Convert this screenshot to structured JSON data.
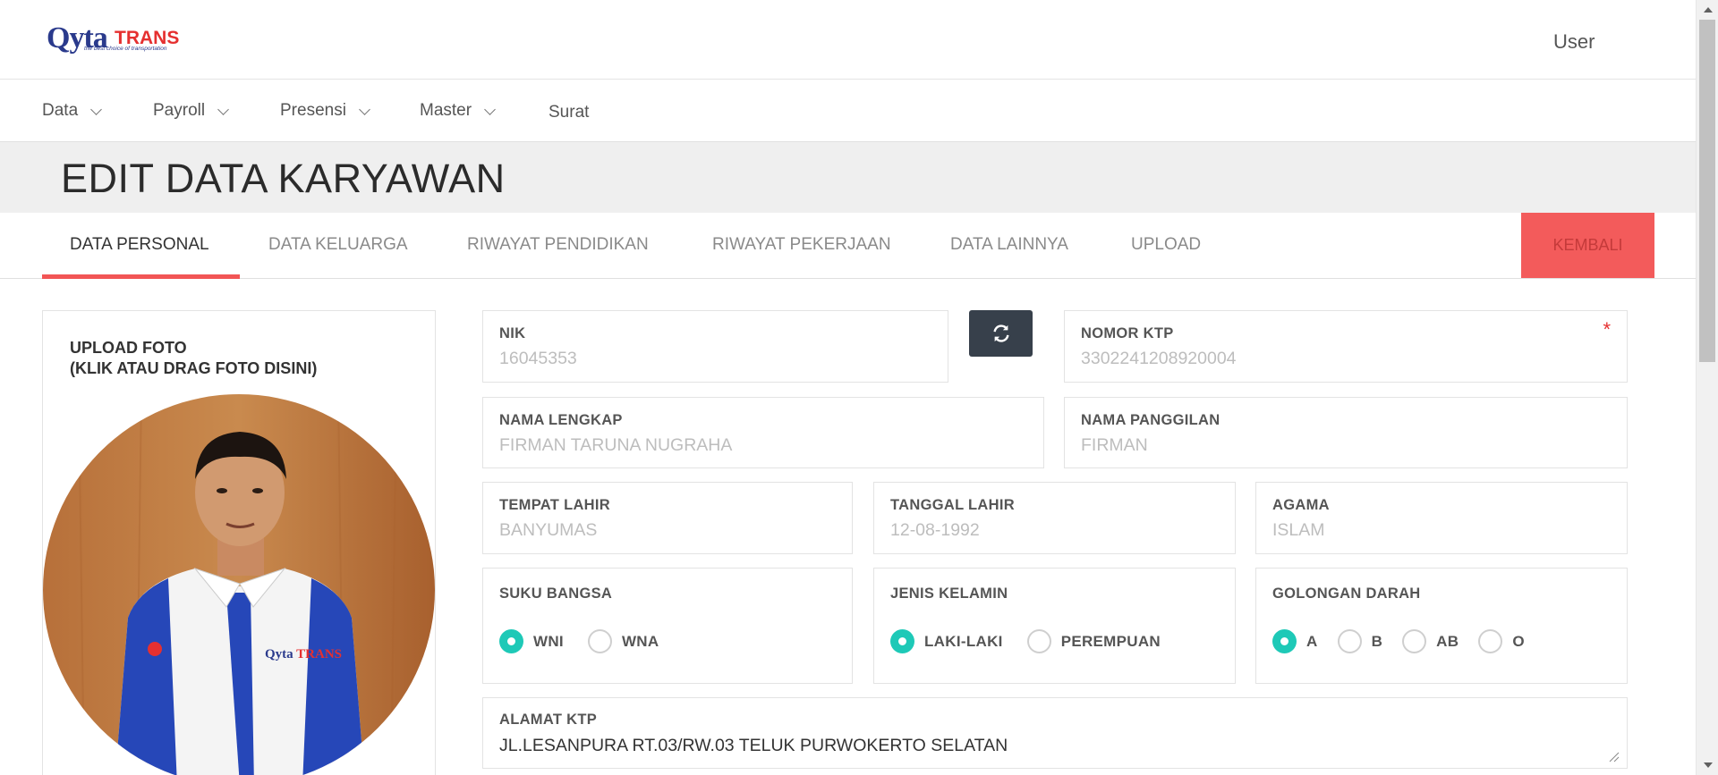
{
  "brand": {
    "logo_main": "Qyta",
    "logo_accent": "TRANS",
    "tagline": "the best choice of transportation"
  },
  "header": {
    "user_label": "User"
  },
  "nav": {
    "items": [
      {
        "label": "Data"
      },
      {
        "label": "Payroll"
      },
      {
        "label": "Presensi"
      },
      {
        "label": "Master"
      },
      {
        "label": "Surat"
      }
    ]
  },
  "page": {
    "title": "EDIT DATA KARYAWAN"
  },
  "tabs": {
    "items": [
      {
        "label": "DATA PERSONAL"
      },
      {
        "label": "DATA KELUARGA"
      },
      {
        "label": "RIWAYAT PENDIDIKAN"
      },
      {
        "label": "RIWAYAT PEKERJAAN"
      },
      {
        "label": "DATA LAINNYA"
      },
      {
        "label": "UPLOAD"
      }
    ],
    "active": "DATA PERSONAL",
    "back_label": "KEMBALI"
  },
  "photo": {
    "title_line1": "UPLOAD FOTO",
    "title_line2": "(KLIK ATAU DRAG FOTO DISINI)",
    "shirt_text": "Qyta TRANS"
  },
  "form": {
    "nik": {
      "label": "NIK",
      "value": "16045353"
    },
    "nomor_ktp": {
      "label": "NOMOR KTP",
      "value": "3302241208920004",
      "required_mark": "*"
    },
    "nama_lengkap": {
      "label": "NAMA LENGKAP",
      "value": "FIRMAN TARUNA NUGRAHA"
    },
    "nama_panggilan": {
      "label": "NAMA PANGGILAN",
      "value": "FIRMAN"
    },
    "tempat_lahir": {
      "label": "TEMPAT LAHIR",
      "value": "BANYUMAS"
    },
    "tanggal_lahir": {
      "label": "TANGGAL LAHIR",
      "value": "12-08-1992"
    },
    "agama": {
      "label": "AGAMA",
      "value": "ISLAM"
    },
    "suku_bangsa": {
      "label": "SUKU BANGSA",
      "options": [
        "WNI",
        "WNA"
      ],
      "selected": "WNI"
    },
    "jenis_kelamin": {
      "label": "JENIS KELAMIN",
      "options": [
        "LAKI-LAKI",
        "PEREMPUAN"
      ],
      "selected": "LAKI-LAKI"
    },
    "golongan_darah": {
      "label": "GOLONGAN DARAH",
      "options": [
        "A",
        "B",
        "AB",
        "O"
      ],
      "selected": "A"
    },
    "alamat_ktp": {
      "label": "ALAMAT KTP",
      "value": "JL.LESANPURA RT.03/RW.03 TELUK PURWOKERTO SELATAN"
    }
  },
  "colors": {
    "accent": "#f35b5b",
    "radio_on": "#1ec9b7",
    "refresh_bg": "#37404b",
    "title_band": "#efefef"
  }
}
